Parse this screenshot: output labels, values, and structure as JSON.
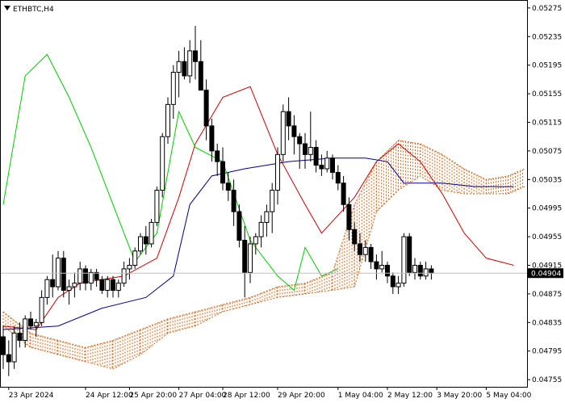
{
  "chart_data": {
    "type": "candlestick",
    "title": "ETHBTC,H4",
    "title_icon": "triangle-down-icon",
    "price_axis": {
      "position": "right",
      "ylim": [
        0.04745,
        0.05285
      ],
      "ticks": [
        "0.05275",
        "0.05235",
        "0.05195",
        "0.05155",
        "0.05115",
        "0.05075",
        "0.05035",
        "0.04995",
        "0.04955",
        "0.04915",
        "0.04875",
        "0.04835",
        "0.04795",
        "0.04755"
      ]
    },
    "time_axis": {
      "labels": [
        {
          "text": "23 Apr 2024",
          "bar": 1
        },
        {
          "text": "24 Apr 12:00",
          "bar": 15
        },
        {
          "text": "25 Apr 20:00",
          "bar": 23
        },
        {
          "text": "27 Apr 04:00",
          "bar": 32
        },
        {
          "text": "28 Apr 12:00",
          "bar": 40
        },
        {
          "text": "29 Apr 20:00",
          "bar": 50
        },
        {
          "text": "1 May 04:00",
          "bar": 61
        },
        {
          "text": "2 May 12:00",
          "bar": 70
        },
        {
          "text": "3 May 20:00",
          "bar": 79
        },
        {
          "text": "5 May 04:00",
          "bar": 88
        }
      ]
    },
    "current_price": {
      "value": 0.04904,
      "label": "0.04904"
    },
    "colors": {
      "candle_body": "#000000",
      "candle_up_fill": "#ffffff",
      "candle_down_fill": "#000000",
      "tenkan": "#cc0000",
      "kijun": "#00008b",
      "chikou": "#00cc00",
      "cloud": "#d2691e",
      "current_price_line": "#c0c0c0",
      "current_price_label_bg": "#000000",
      "current_price_label_text": "#ffffff"
    },
    "candles": [
      [
        0.04815,
        0.0483,
        0.0477,
        0.0479
      ],
      [
        0.0479,
        0.0481,
        0.0476,
        0.0478
      ],
      [
        0.0478,
        0.0483,
        0.0477,
        0.0482
      ],
      [
        0.0482,
        0.04835,
        0.048,
        0.0481
      ],
      [
        0.0481,
        0.04845,
        0.048,
        0.0484
      ],
      [
        0.0484,
        0.0485,
        0.04825,
        0.0483
      ],
      [
        0.0483,
        0.0484,
        0.04815,
        0.04835
      ],
      [
        0.04835,
        0.0488,
        0.0483,
        0.0487
      ],
      [
        0.0487,
        0.049,
        0.0486,
        0.04895
      ],
      [
        0.04895,
        0.0493,
        0.0487,
        0.04885
      ],
      [
        0.04885,
        0.04935,
        0.0488,
        0.04925
      ],
      [
        0.04925,
        0.04935,
        0.0487,
        0.0488
      ],
      [
        0.0488,
        0.04895,
        0.0486,
        0.04885
      ],
      [
        0.04885,
        0.04905,
        0.0487,
        0.0489
      ],
      [
        0.0489,
        0.0492,
        0.0488,
        0.0491
      ],
      [
        0.0491,
        0.04915,
        0.0488,
        0.0489
      ],
      [
        0.0489,
        0.0491,
        0.0488,
        0.04905
      ],
      [
        0.04905,
        0.0491,
        0.04885,
        0.04895
      ],
      [
        0.04895,
        0.049,
        0.04875,
        0.0488
      ],
      [
        0.0488,
        0.049,
        0.0487,
        0.04895
      ],
      [
        0.04895,
        0.049,
        0.0487,
        0.0488
      ],
      [
        0.0488,
        0.04895,
        0.0487,
        0.0489
      ],
      [
        0.0489,
        0.0492,
        0.04885,
        0.0491
      ],
      [
        0.0491,
        0.04925,
        0.04895,
        0.04915
      ],
      [
        0.04915,
        0.0494,
        0.0491,
        0.04935
      ],
      [
        0.04935,
        0.0496,
        0.0493,
        0.04955
      ],
      [
        0.04955,
        0.0497,
        0.0493,
        0.04945
      ],
      [
        0.04945,
        0.0498,
        0.0494,
        0.04975
      ],
      [
        0.04975,
        0.05025,
        0.0497,
        0.0502
      ],
      [
        0.0502,
        0.051,
        0.0501,
        0.05095
      ],
      [
        0.05095,
        0.0515,
        0.05085,
        0.0514
      ],
      [
        0.0514,
        0.05195,
        0.0512,
        0.05185
      ],
      [
        0.05185,
        0.05215,
        0.0515,
        0.052
      ],
      [
        0.052,
        0.0522,
        0.05175,
        0.0518
      ],
      [
        0.0518,
        0.0523,
        0.0517,
        0.05215
      ],
      [
        0.05215,
        0.0525,
        0.05175,
        0.052
      ],
      [
        0.052,
        0.0523,
        0.0518,
        0.0516
      ],
      [
        0.0516,
        0.05175,
        0.0509,
        0.0511
      ],
      [
        0.0511,
        0.0512,
        0.0506,
        0.05075
      ],
      [
        0.05075,
        0.05085,
        0.0504,
        0.0506
      ],
      [
        0.0506,
        0.0508,
        0.0502,
        0.0503
      ],
      [
        0.0503,
        0.05045,
        0.05005,
        0.0502
      ],
      [
        0.0502,
        0.05035,
        0.0497,
        0.0499
      ],
      [
        0.0499,
        0.05,
        0.0494,
        0.0495
      ],
      [
        0.0495,
        0.0497,
        0.0487,
        0.04905
      ],
      [
        0.04905,
        0.04955,
        0.0489,
        0.04945
      ],
      [
        0.04945,
        0.0496,
        0.0493,
        0.04955
      ],
      [
        0.04955,
        0.04985,
        0.0494,
        0.04975
      ],
      [
        0.04975,
        0.05,
        0.04955,
        0.0499
      ],
      [
        0.0499,
        0.0503,
        0.0496,
        0.0502
      ],
      [
        0.0502,
        0.0508,
        0.05,
        0.0507
      ],
      [
        0.0507,
        0.0514,
        0.0506,
        0.0513
      ],
      [
        0.0513,
        0.0515,
        0.0509,
        0.0511
      ],
      [
        0.0511,
        0.05125,
        0.0507,
        0.05095
      ],
      [
        0.05095,
        0.051,
        0.0505,
        0.05085
      ],
      [
        0.05085,
        0.051,
        0.0505,
        0.0507
      ],
      [
        0.0507,
        0.0513,
        0.0506,
        0.0508
      ],
      [
        0.0508,
        0.0509,
        0.05045,
        0.05055
      ],
      [
        0.05055,
        0.0507,
        0.0504,
        0.0505
      ],
      [
        0.0505,
        0.05075,
        0.05045,
        0.05065
      ],
      [
        0.05065,
        0.0507,
        0.05035,
        0.05045
      ],
      [
        0.05045,
        0.05055,
        0.0502,
        0.0503
      ],
      [
        0.0503,
        0.0504,
        0.0499,
        0.05
      ],
      [
        0.05,
        0.0501,
        0.0495,
        0.04965
      ],
      [
        0.04965,
        0.04975,
        0.04935,
        0.04945
      ],
      [
        0.04945,
        0.0496,
        0.0492,
        0.0493
      ],
      [
        0.0493,
        0.0495,
        0.0492,
        0.0494
      ],
      [
        0.0494,
        0.04945,
        0.0491,
        0.0492
      ],
      [
        0.0492,
        0.0493,
        0.04895,
        0.0491
      ],
      [
        0.0491,
        0.04935,
        0.04905,
        0.04915
      ],
      [
        0.04915,
        0.0492,
        0.0489,
        0.049
      ],
      [
        0.049,
        0.04905,
        0.04875,
        0.04885
      ],
      [
        0.04885,
        0.049,
        0.04875,
        0.0489
      ],
      [
        0.0489,
        0.0496,
        0.04885,
        0.04955
      ],
      [
        0.04955,
        0.0496,
        0.049,
        0.04905
      ],
      [
        0.04905,
        0.04925,
        0.04895,
        0.04915
      ],
      [
        0.04915,
        0.0492,
        0.04895,
        0.049
      ],
      [
        0.049,
        0.0492,
        0.04895,
        0.0491
      ],
      [
        0.0491,
        0.04915,
        0.04895,
        0.04904
      ]
    ],
    "tenkan": [
      [
        0,
        0.0483
      ],
      [
        6,
        0.04825
      ],
      [
        10,
        0.0487
      ],
      [
        14,
        0.0489
      ],
      [
        22,
        0.049
      ],
      [
        28,
        0.04925
      ],
      [
        32,
        0.0501
      ],
      [
        35,
        0.05085
      ],
      [
        40,
        0.0515
      ],
      [
        45,
        0.05165
      ],
      [
        50,
        0.0507
      ],
      [
        55,
        0.05
      ],
      [
        58,
        0.0496
      ],
      [
        64,
        0.0501
      ],
      [
        68,
        0.0506
      ],
      [
        72,
        0.05085
      ],
      [
        76,
        0.0506
      ],
      [
        80,
        0.05015
      ],
      [
        84,
        0.0496
      ],
      [
        88,
        0.04925
      ],
      [
        93,
        0.04915
      ]
    ],
    "kijun": [
      [
        0,
        0.04825
      ],
      [
        10,
        0.0483
      ],
      [
        18,
        0.04855
      ],
      [
        26,
        0.0487
      ],
      [
        31,
        0.049
      ],
      [
        34,
        0.05
      ],
      [
        38,
        0.0504
      ],
      [
        44,
        0.0505
      ],
      [
        52,
        0.0506
      ],
      [
        60,
        0.05065
      ],
      [
        66,
        0.05065
      ],
      [
        70,
        0.0506
      ],
      [
        73,
        0.0503
      ],
      [
        80,
        0.0503
      ],
      [
        86,
        0.05025
      ],
      [
        93,
        0.05025
      ]
    ],
    "chikou": [
      [
        0,
        0.05
      ],
      [
        4,
        0.0518
      ],
      [
        8,
        0.0521
      ],
      [
        12,
        0.0515
      ],
      [
        16,
        0.0508
      ],
      [
        20,
        0.05
      ],
      [
        24,
        0.0492
      ],
      [
        28,
        0.0496
      ],
      [
        32,
        0.0513
      ],
      [
        35,
        0.0508
      ],
      [
        40,
        0.0506
      ],
      [
        45,
        0.0495
      ],
      [
        50,
        0.049
      ],
      [
        53,
        0.0488
      ],
      [
        55,
        0.0494
      ],
      [
        58,
        0.049
      ],
      [
        61,
        0.0491
      ]
    ],
    "cloud": [
      [
        0,
        0.0485,
        0.0483
      ],
      [
        5,
        0.0482,
        0.048
      ],
      [
        10,
        0.0481,
        0.0479
      ],
      [
        15,
        0.048,
        0.0478
      ],
      [
        20,
        0.0481,
        0.0477
      ],
      [
        25,
        0.04825,
        0.0479
      ],
      [
        30,
        0.0484,
        0.0482
      ],
      [
        35,
        0.0485,
        0.0483
      ],
      [
        40,
        0.0486,
        0.0485
      ],
      [
        45,
        0.0487,
        0.0486
      ],
      [
        50,
        0.04885,
        0.0487
      ],
      [
        55,
        0.0489,
        0.04875
      ],
      [
        60,
        0.04905,
        0.0488
      ],
      [
        64,
        0.05,
        0.04885
      ],
      [
        68,
        0.0506,
        0.0499
      ],
      [
        72,
        0.0509,
        0.0502
      ],
      [
        76,
        0.05085,
        0.0504
      ],
      [
        80,
        0.0507,
        0.0502
      ],
      [
        84,
        0.0505,
        0.05015
      ],
      [
        88,
        0.05035,
        0.05015
      ],
      [
        92,
        0.0504,
        0.05015
      ],
      [
        95,
        0.0505,
        0.05025
      ]
    ]
  }
}
